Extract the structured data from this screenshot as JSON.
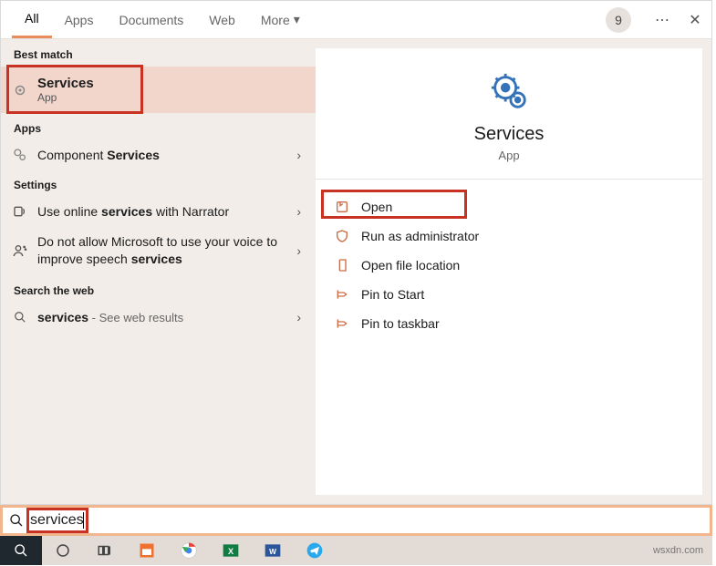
{
  "tabs": {
    "items": [
      "All",
      "Apps",
      "Documents",
      "Web",
      "More"
    ],
    "active": "All",
    "badge": "9"
  },
  "left": {
    "best_match_header": "Best match",
    "best_match": {
      "title": "Services",
      "subtitle": "App"
    },
    "apps_header": "Apps",
    "apps": [
      {
        "prefix": "Component ",
        "bold": "Services"
      }
    ],
    "settings_header": "Settings",
    "settings": [
      {
        "pre": "Use online ",
        "bold": "services",
        "post": " with Narrator"
      },
      {
        "pre": "Do not allow Microsoft to use your voice to improve speech ",
        "bold": "services",
        "post": ""
      }
    ],
    "web_header": "Search the web",
    "web": {
      "bold": "services",
      "desc": " - See web results"
    }
  },
  "preview": {
    "title": "Services",
    "subtitle": "App",
    "actions": [
      "Open",
      "Run as administrator",
      "Open file location",
      "Pin to Start",
      "Pin to taskbar"
    ]
  },
  "search_input": "services",
  "watermark": "wsxdn.com"
}
